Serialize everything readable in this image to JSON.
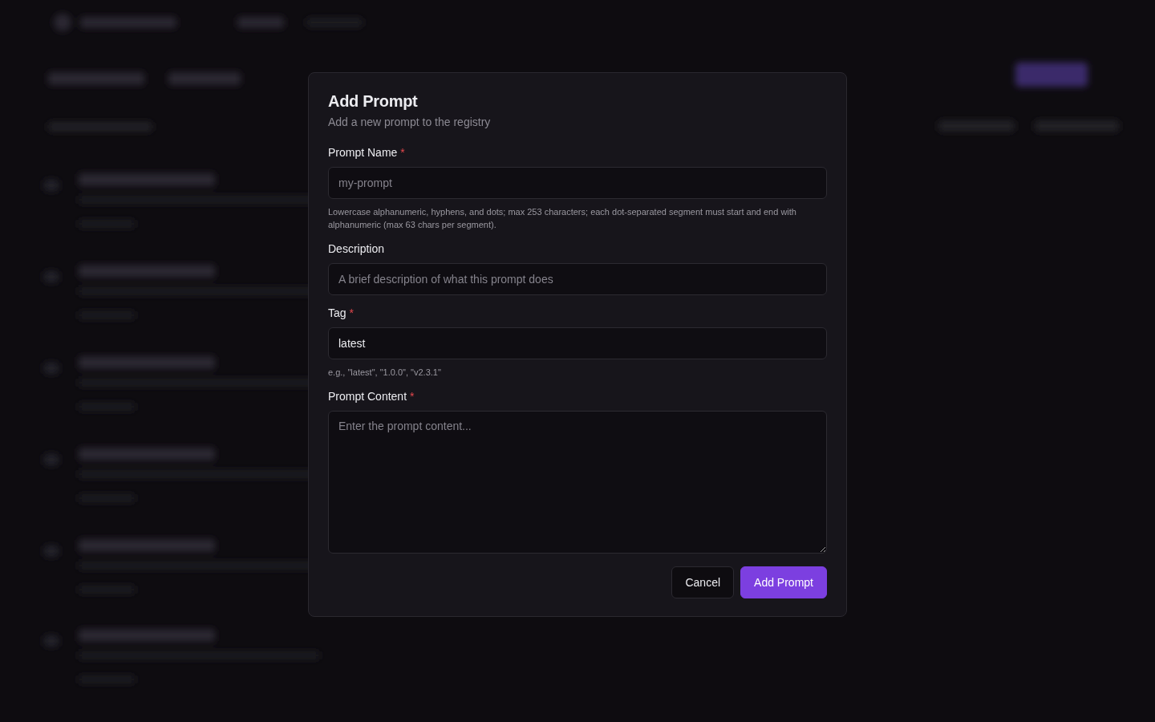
{
  "dialog": {
    "title": "Add Prompt",
    "subtitle": "Add a new prompt to the registry",
    "fields": [
      {
        "kind": "input",
        "label": "Prompt Name",
        "required_mark": "*",
        "placeholder": "my-prompt",
        "hint": "Lowercase alphanumeric, hyphens, and dots; max 253 characters; each dot-separated segment must start and end with alphanumeric (max 63 chars per segment)."
      },
      {
        "kind": "input",
        "label": "Description",
        "placeholder": "A brief description of what this prompt does"
      },
      {
        "kind": "input",
        "label": "Tag",
        "required_mark": "*",
        "value": "latest",
        "hint": "e.g., \"latest\", \"1.0.0\", \"v2.3.1\""
      },
      {
        "kind": "textarea",
        "label": "Prompt Content",
        "required_mark": "*",
        "placeholder": "Enter the prompt content..."
      }
    ],
    "buttons": [
      {
        "kind": "secondary",
        "label": "Cancel"
      },
      {
        "kind": "primary",
        "label": "Add Prompt"
      }
    ]
  }
}
